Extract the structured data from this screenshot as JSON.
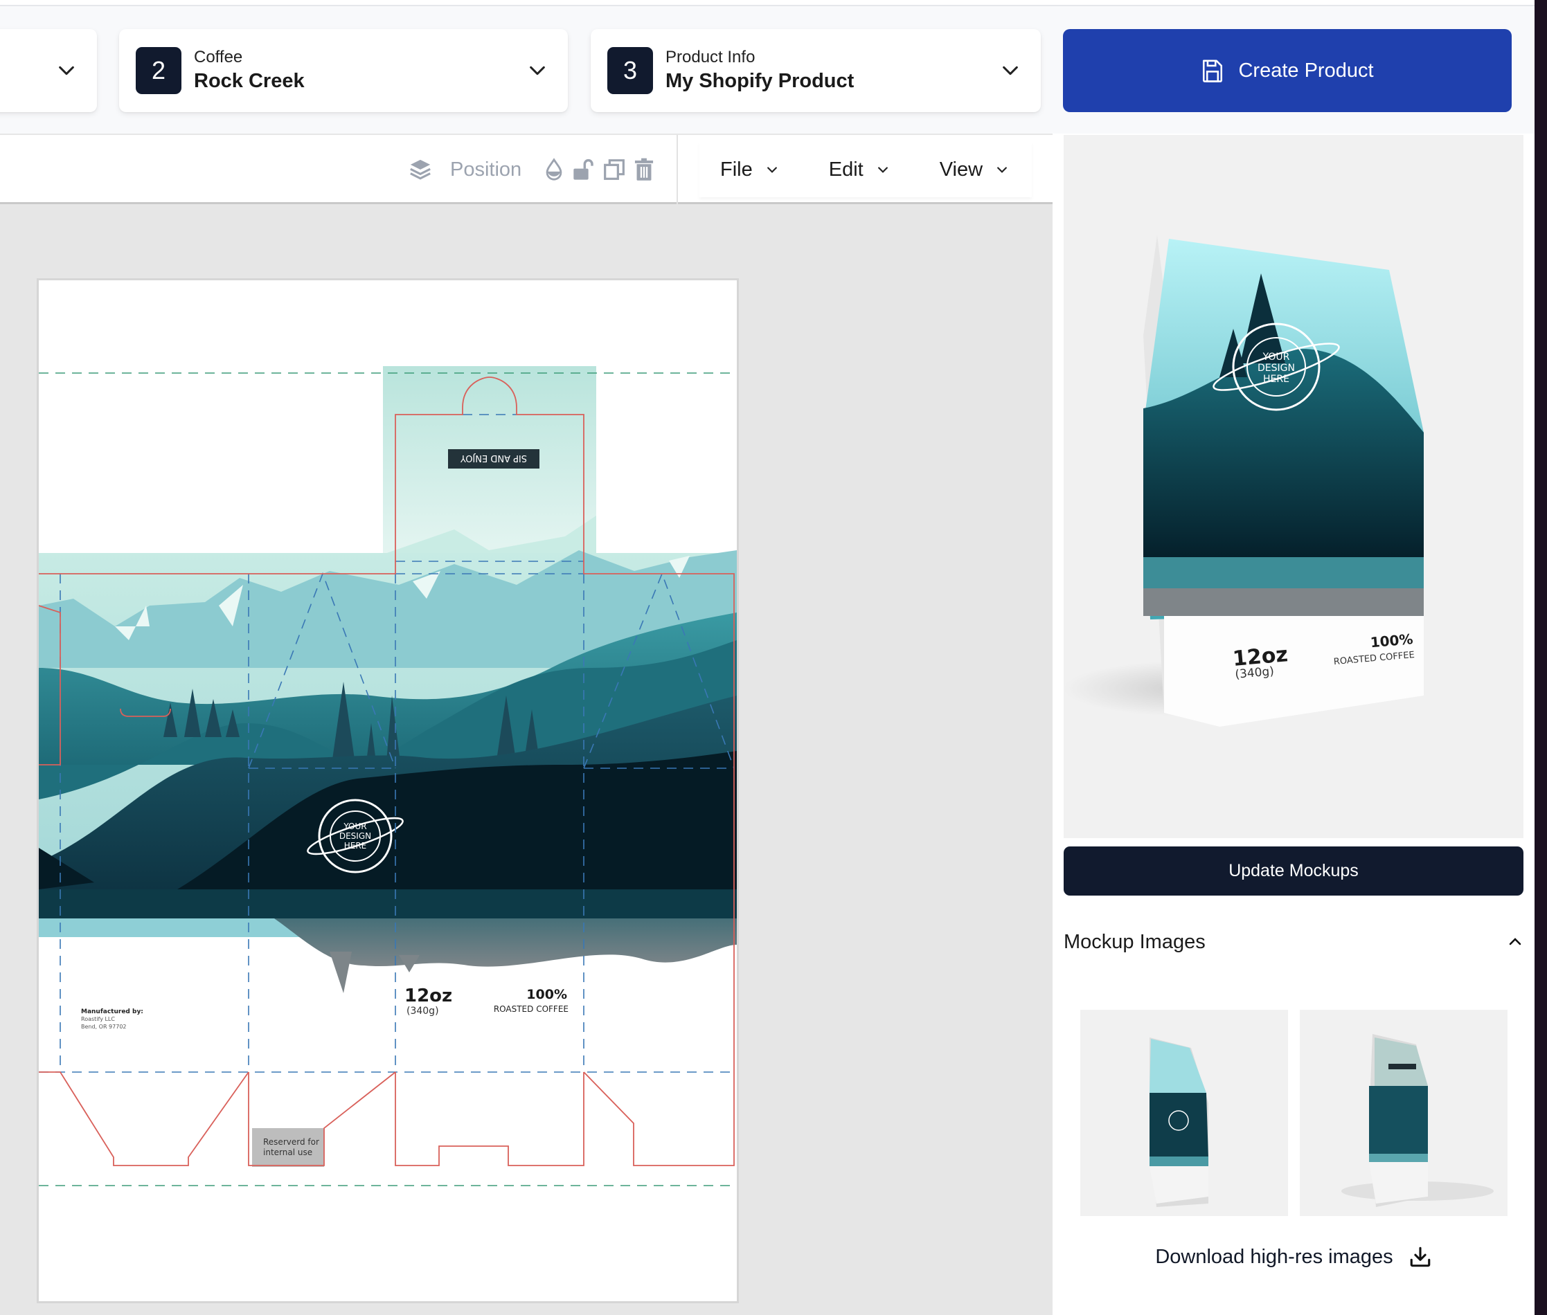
{
  "steps": [
    {
      "number": "",
      "label": "",
      "value": ""
    },
    {
      "number": "2",
      "label": "Coffee",
      "value": "Rock Creek"
    },
    {
      "number": "3",
      "label": "Product Info",
      "value": "My Shopify Product"
    }
  ],
  "create_button": {
    "label": "Create Product",
    "icon": "save-icon"
  },
  "toolbar": {
    "position_label": "Position",
    "icons": [
      "layers-icon",
      "opacity-icon",
      "unlock-icon",
      "duplicate-icon",
      "trash-icon"
    ],
    "menus": [
      {
        "label": "File"
      },
      {
        "label": "Edit"
      },
      {
        "label": "View"
      }
    ]
  },
  "dieline": {
    "flap_label": "SIP AND ENJOY",
    "logo_text": [
      "YOUR",
      "DESIGN",
      "HERE"
    ],
    "weight_main": "12oz",
    "weight_sub": "(340g)",
    "percent": "100%",
    "percent_sub": "ROASTED COFFEE",
    "manufacturer_heading": "Manufactured by:",
    "manufacturer_lines": [
      "Roastify LLC",
      "Bend, OR 97702"
    ],
    "reserved_lines": [
      "Reserverd for",
      "internal use"
    ],
    "colors": {
      "cut_line": "#d9605a",
      "fold_line": "#3a78b5",
      "bleed_line": "#3d9b78"
    }
  },
  "right_panel": {
    "mockup_logo_text": [
      "YOUR",
      "DESIGN",
      "HERE"
    ],
    "mockup_weight_main": "12oz",
    "mockup_weight_sub": "(340g)",
    "mockup_percent": "100%",
    "mockup_percent_sub": "ROASTED COFFEE",
    "update_button": "Update Mockups",
    "mockup_images_title": "Mockup Images",
    "thumbnails": [
      {
        "alt": "Front mockup view"
      },
      {
        "alt": "Back mockup view"
      }
    ],
    "download_label": "Download high-res images"
  },
  "colors": {
    "primary": "#1f40ad",
    "dark": "#111a2e"
  }
}
